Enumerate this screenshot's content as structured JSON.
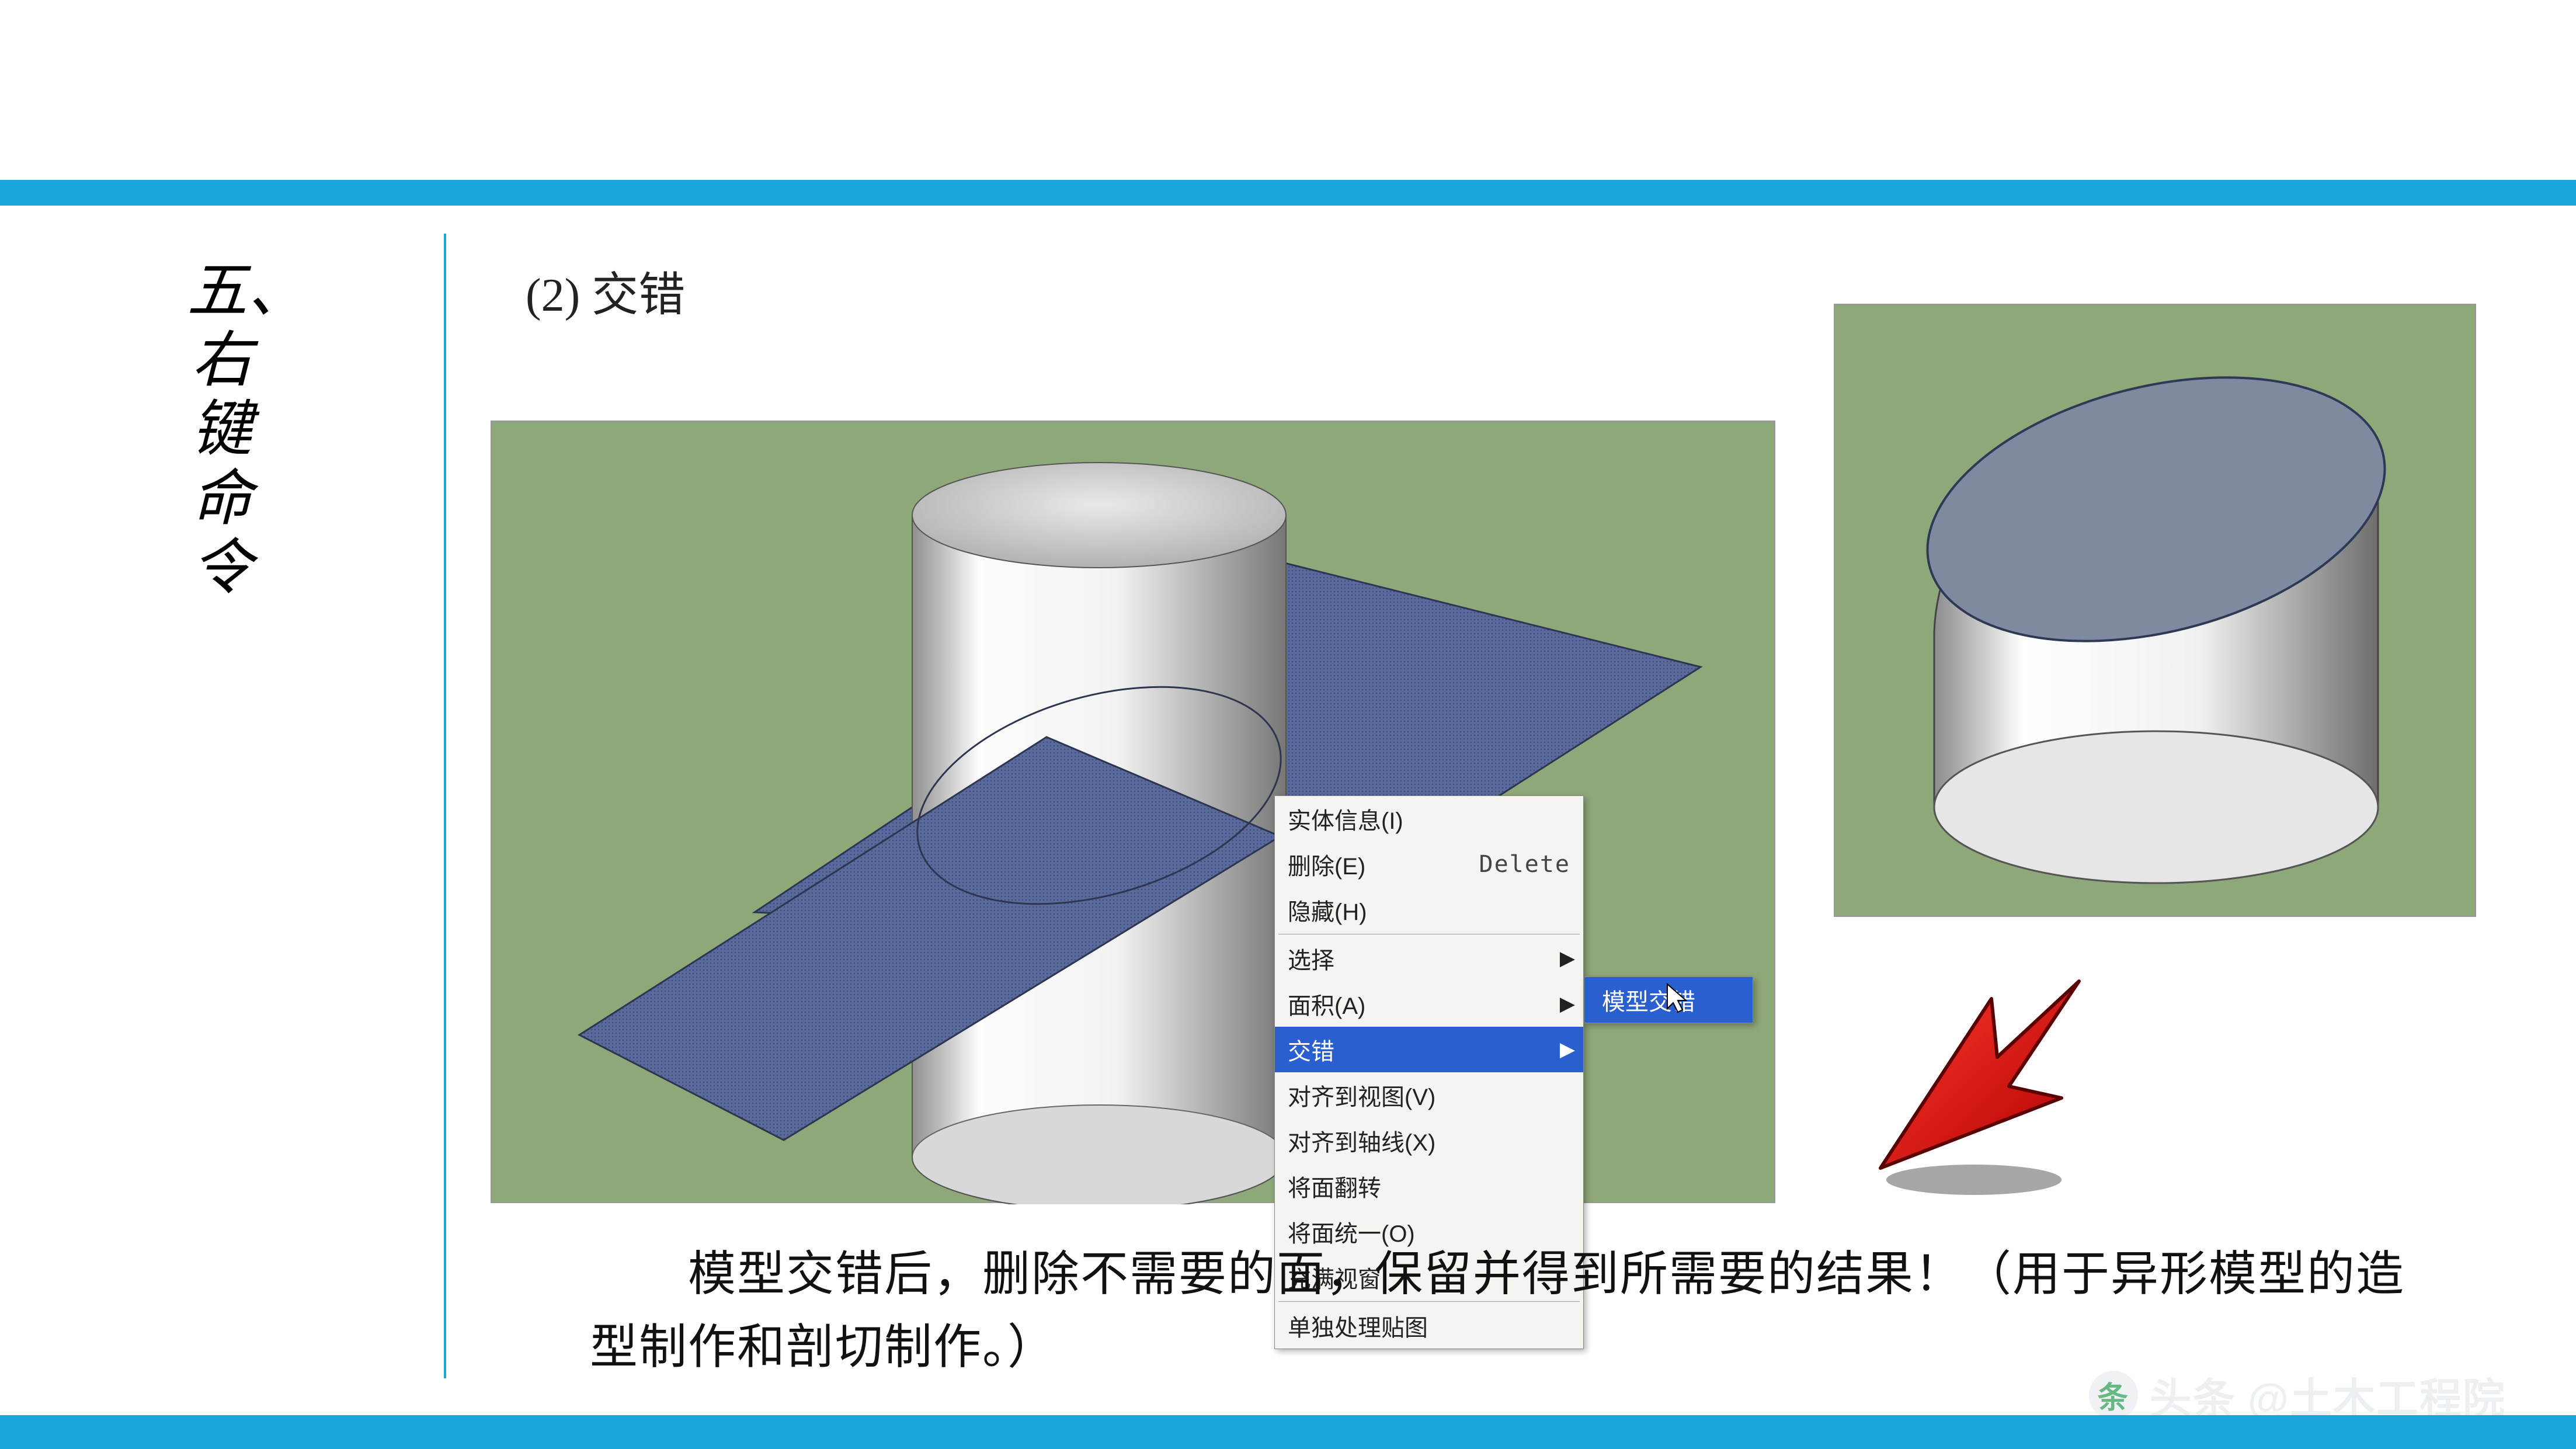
{
  "header": {
    "section_title": "五、右键命令"
  },
  "subtitle": "(2) 交错",
  "context_menu": {
    "items_top": [
      {
        "label": "实体信息(I)",
        "shortcut": ""
      },
      {
        "label": "删除(E)",
        "shortcut": "Delete"
      },
      {
        "label": "隐藏(H)",
        "shortcut": ""
      }
    ],
    "items_mid": [
      {
        "label": "选择",
        "has_sub": true
      },
      {
        "label": "面积(A)",
        "has_sub": true
      },
      {
        "label": "交错",
        "has_sub": true,
        "highlight": true
      },
      {
        "label": "对齐到视图(V)"
      },
      {
        "label": "对齐到轴线(X)"
      },
      {
        "label": "将面翻转"
      },
      {
        "label": "将面统一(O)"
      },
      {
        "label": "充满视窗"
      }
    ],
    "items_bot": [
      {
        "label": "单独处理贴图"
      }
    ],
    "submenu": {
      "label": "模型交错"
    }
  },
  "explain_text": "　　模型交错后，删除不需要的面，保留并得到所需要的结果！（用于异形模型的造型制作和剖切制作。）",
  "watermark": {
    "prefix": "头条",
    "handle": "@土木工程院"
  },
  "colors": {
    "accent": "#1ba6da",
    "viewport_bg": "#8fa87a",
    "menu_hl": "#2a5fcf",
    "arrow_red": "#e10f0f"
  }
}
